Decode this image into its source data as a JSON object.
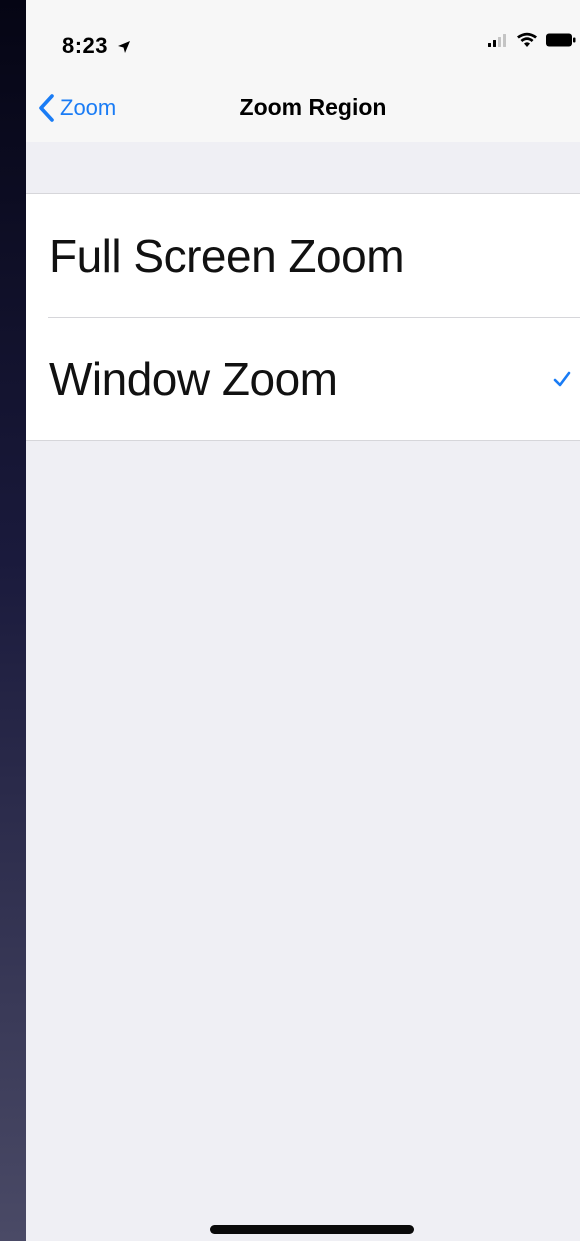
{
  "status_bar": {
    "time": "8:23",
    "location_icon": "location-arrow-icon",
    "signal_icon": "cellular-signal-icon",
    "wifi_icon": "wifi-icon",
    "battery_icon": "battery-icon"
  },
  "nav": {
    "back_label": "Zoom",
    "back_icon": "chevron-left-icon",
    "title": "Zoom Region"
  },
  "options": [
    {
      "label": "Full Screen Zoom",
      "selected": false
    },
    {
      "label": "Window Zoom",
      "selected": true
    }
  ],
  "colors": {
    "accent": "#1a7cf5",
    "grouped_background": "#efeff4",
    "bar_background": "#f7f7f7",
    "separator": "#d6d6da"
  }
}
